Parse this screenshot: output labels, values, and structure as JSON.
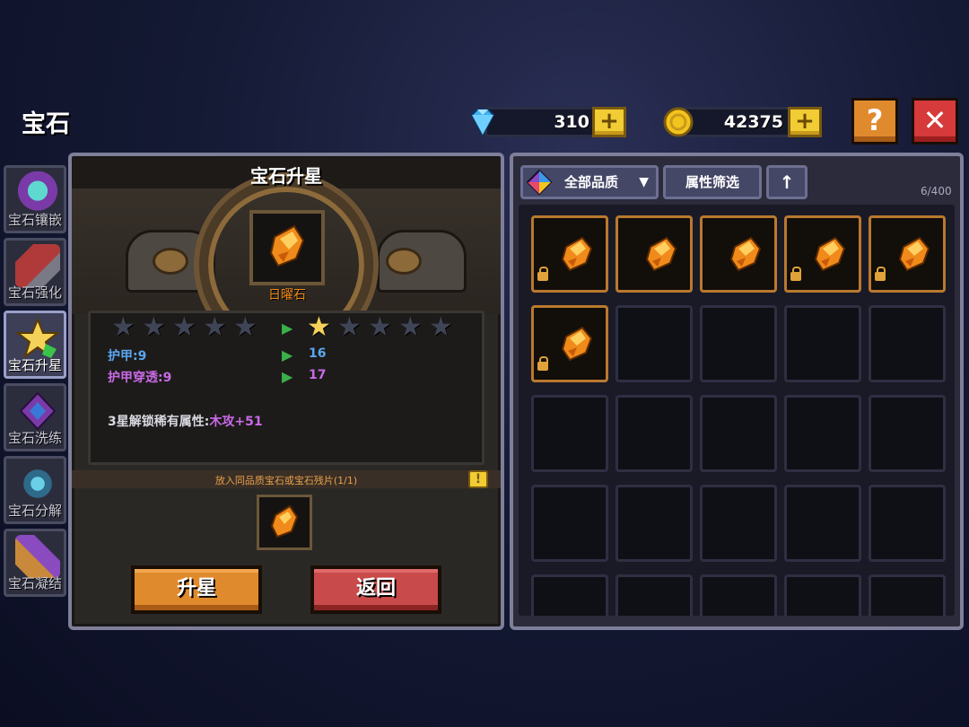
{
  "header": {
    "title": "宝石"
  },
  "currency": {
    "diamonds": "310",
    "gold": "42375"
  },
  "buttons": {
    "help": "?",
    "close": "✕",
    "plus": "+"
  },
  "side_tabs": [
    {
      "label": "宝石镶嵌",
      "icon": "gem-inlay-icon"
    },
    {
      "label": "宝石强化",
      "icon": "gem-enhance-icon"
    },
    {
      "label": "宝石升星",
      "icon": "gem-star-icon",
      "active": true
    },
    {
      "label": "宝石洗练",
      "icon": "gem-refine-icon"
    },
    {
      "label": "宝石分解",
      "icon": "gem-decompose-icon"
    },
    {
      "label": "宝石凝结",
      "icon": "gem-condense-icon"
    }
  ],
  "upgrade_panel": {
    "title": "宝石升星",
    "gem_name": "日曜石",
    "current_stars": 0,
    "next_stars": 1,
    "max_stars": 5,
    "stats": [
      {
        "label": "护甲:9",
        "next": "16"
      },
      {
        "label": "护甲穿透:9",
        "next": "17"
      }
    ],
    "unlock_text": "3星解锁稀有属性:",
    "unlock_value": "木攻+51",
    "hint": "放入同品质宝石或宝石残片(1/1)",
    "info": "!",
    "upgrade_label": "升星",
    "back_label": "返回"
  },
  "inventory": {
    "quality_filter": "全部品质",
    "attr_filter": "属性筛选",
    "sort_icon": "arrow-up-icon",
    "count": "6/400",
    "items": [
      {
        "gem": "日曜石",
        "locked": true
      },
      {
        "gem": "日曜石",
        "locked": false
      },
      {
        "gem": "日曜石",
        "locked": false
      },
      {
        "gem": "日曜石",
        "locked": true
      },
      {
        "gem": "日曜石",
        "locked": true
      },
      {
        "gem": "日曜石",
        "locked": true
      }
    ]
  },
  "colors": {
    "accent_orange": "#e08a2e",
    "accent_red": "#c84a4a",
    "gem_orange": "#f08a1a",
    "stat_blue": "#5aa6f0",
    "stat_purple": "#c86ae6"
  }
}
